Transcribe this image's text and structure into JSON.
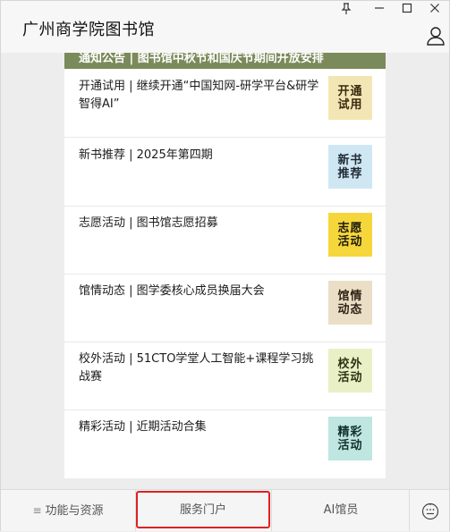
{
  "window": {
    "title": "广州商学院图书馆"
  },
  "window_controls": {
    "pin": "⊥",
    "minimize": "—",
    "maximize": "□",
    "close": "✕"
  },
  "banner": {
    "text": "通知公告 | 图书馆中秋节和国庆节期间开放安排"
  },
  "articles": [
    {
      "title": "开通试用 | 继续开通“中国知网-研学平台&研学智得AI”",
      "thumb_text": [
        "开通",
        "试用"
      ],
      "thumb_bg": "#f3e6b5",
      "thumb_fg": "#3a2a10"
    },
    {
      "title": "新书推荐 | 2025年第四期",
      "thumb_text": [
        "新书",
        "推荐"
      ],
      "thumb_bg": "#cfe7f3",
      "thumb_fg": "#1f2a33"
    },
    {
      "title": "志愿活动 | 图书馆志愿招募",
      "thumb_text": [
        "志愿",
        "活动"
      ],
      "thumb_bg": "#f6d73b",
      "thumb_fg": "#1e1a10"
    },
    {
      "title": "馆情动态 | 图学委核心成员换届大会",
      "thumb_text": [
        "馆情",
        "动态"
      ],
      "thumb_bg": "#eadfc6",
      "thumb_fg": "#2f2415"
    },
    {
      "title": "校外活动 | 51CTO学堂人工智能+课程学习挑战赛",
      "thumb_text": [
        "校外",
        "活动"
      ],
      "thumb_bg": "#e9f0c6",
      "thumb_fg": "#2c3212"
    },
    {
      "title": "精彩活动 | 近期活动合集",
      "thumb_text": [
        "精彩",
        "活动"
      ],
      "thumb_bg": "#bfe6e0",
      "thumb_fg": "#10302c"
    }
  ],
  "tabs": {
    "functions": "功能与资源",
    "service": "服务门户",
    "librarian": "AI馆员"
  },
  "colors": {
    "highlight": "#e02020",
    "banner": "#7b8a5a"
  }
}
